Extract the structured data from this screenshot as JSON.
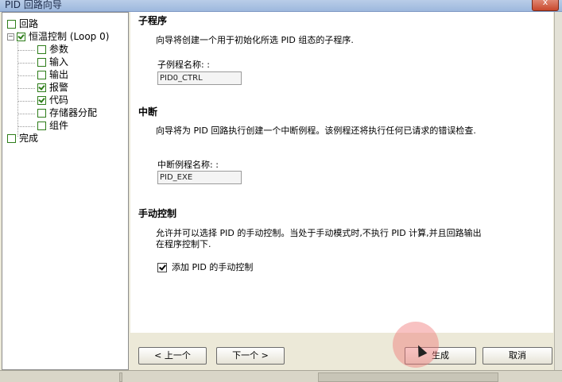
{
  "window": {
    "title": "PID 回路向导",
    "close_label": "x"
  },
  "tree": {
    "items": [
      {
        "label": "回路",
        "checked": false
      },
      {
        "label": "恒温控制 (Loop 0)",
        "checked": true,
        "expander": "−"
      },
      {
        "label": "参数",
        "checked": false
      },
      {
        "label": "输入",
        "checked": false
      },
      {
        "label": "输出",
        "checked": false
      },
      {
        "label": "报警",
        "checked": true
      },
      {
        "label": "代码",
        "checked": true
      },
      {
        "label": "存储器分配",
        "checked": false
      },
      {
        "label": "组件",
        "checked": false
      },
      {
        "label": "完成",
        "checked": false
      }
    ]
  },
  "content": {
    "subroutine": {
      "title": "子程序",
      "desc": "向导将创建一个用于初始化所选 PID 组态的子程序.",
      "field_label": "子例程名称: :",
      "value": "PID0_CTRL"
    },
    "interrupt": {
      "title": "中断",
      "desc": "向导将为 PID 回路执行创建一个中断例程。该例程还将执行任何已请求的错误检查.",
      "field_label": "中断例程名称: :",
      "value": "PID_EXE"
    },
    "manual": {
      "title": "手动控制",
      "desc_line1": "允许并可以选择 PID 的手动控制。当处于手动模式时,不执行 PID 计算,并且回路输出",
      "desc_line2": "在程序控制下.",
      "checkbox_label": "添加 PID 的手动控制",
      "checkbox_checked": true
    }
  },
  "buttons": {
    "prev": "< 上一个",
    "next": "下一个 >",
    "generate": "生成",
    "cancel": "取消"
  }
}
